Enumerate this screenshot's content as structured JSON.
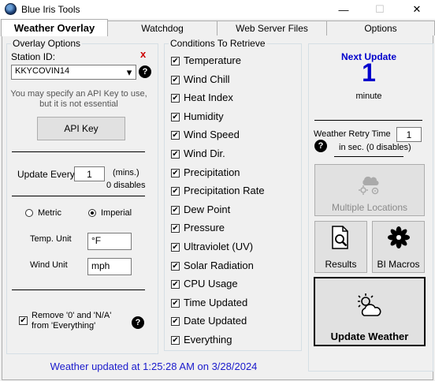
{
  "window": {
    "title": "Blue Iris Tools",
    "minimize_glyph": "—",
    "maximize_glyph": "☐",
    "close_glyph": "✕"
  },
  "tabs": [
    {
      "label": "Weather Overlay",
      "active": true
    },
    {
      "label": "Watchdog",
      "active": false
    },
    {
      "label": "Web Server Files",
      "active": false
    },
    {
      "label": "Options",
      "active": false
    }
  ],
  "overlay": {
    "group_title": "Overlay Options",
    "station_label": "Station ID:",
    "station_value": "KKYCOVIN14",
    "clear_glyph": "x",
    "api_note_line1": "You may specify an API Key to use,",
    "api_note_line2": "but it is not essential",
    "api_key_button": "API Key",
    "update_every_label": "Update Every",
    "update_every_value": "1",
    "mins_label": "(mins.)",
    "disables_label": "0 disables",
    "metric_label": "Metric",
    "imperial_label": "Imperial",
    "unit_selected": "Imperial",
    "temp_unit_label": "Temp. Unit",
    "temp_unit_value": "°F",
    "wind_unit_label": "Wind Unit",
    "wind_unit_value": "mph",
    "remove_line1": "Remove '0' and  'N/A'",
    "remove_line2": "from 'Everything'",
    "remove_checked": true
  },
  "conditions": {
    "group_title": "Conditions To Retrieve",
    "items": [
      {
        "label": "Temperature",
        "checked": true
      },
      {
        "label": "Wind Chill",
        "checked": true
      },
      {
        "label": "Heat Index",
        "checked": true
      },
      {
        "label": "Humidity",
        "checked": true
      },
      {
        "label": "Wind Speed",
        "checked": true
      },
      {
        "label": "Wind Dir.",
        "checked": true
      },
      {
        "label": "Precipitation",
        "checked": true
      },
      {
        "label": "Precipitation Rate",
        "checked": true
      },
      {
        "label": "Dew Point",
        "checked": true
      },
      {
        "label": "Pressure",
        "checked": true
      },
      {
        "label": "Ultraviolet (UV)",
        "checked": true
      },
      {
        "label": "Solar Radiation",
        "checked": true
      },
      {
        "label": "CPU Usage",
        "checked": true
      },
      {
        "label": "Time Updated",
        "checked": true
      },
      {
        "label": "Date Updated",
        "checked": true
      },
      {
        "label": "Everything",
        "checked": true
      }
    ]
  },
  "right": {
    "next_update_label": "Next Update",
    "next_update_value": "1",
    "next_update_unit": "minute",
    "retry_label": "Weather Retry Time",
    "retry_value": "1",
    "retry_sub": "in sec. (0 disables)",
    "multiple_locations": "Multiple Locations",
    "results": "Results",
    "bi_macros": "BI Macros",
    "update_weather": "Update Weather"
  },
  "status": {
    "text": "Weather updated at 1:25:28 AM on 3/28/2024"
  },
  "colors": {
    "accent_blue": "#0000cc",
    "status_blue": "#1a1acc",
    "error_red": "#cc0000"
  },
  "icons": {
    "help": "?",
    "check": "✔",
    "dropdown": "▾"
  }
}
